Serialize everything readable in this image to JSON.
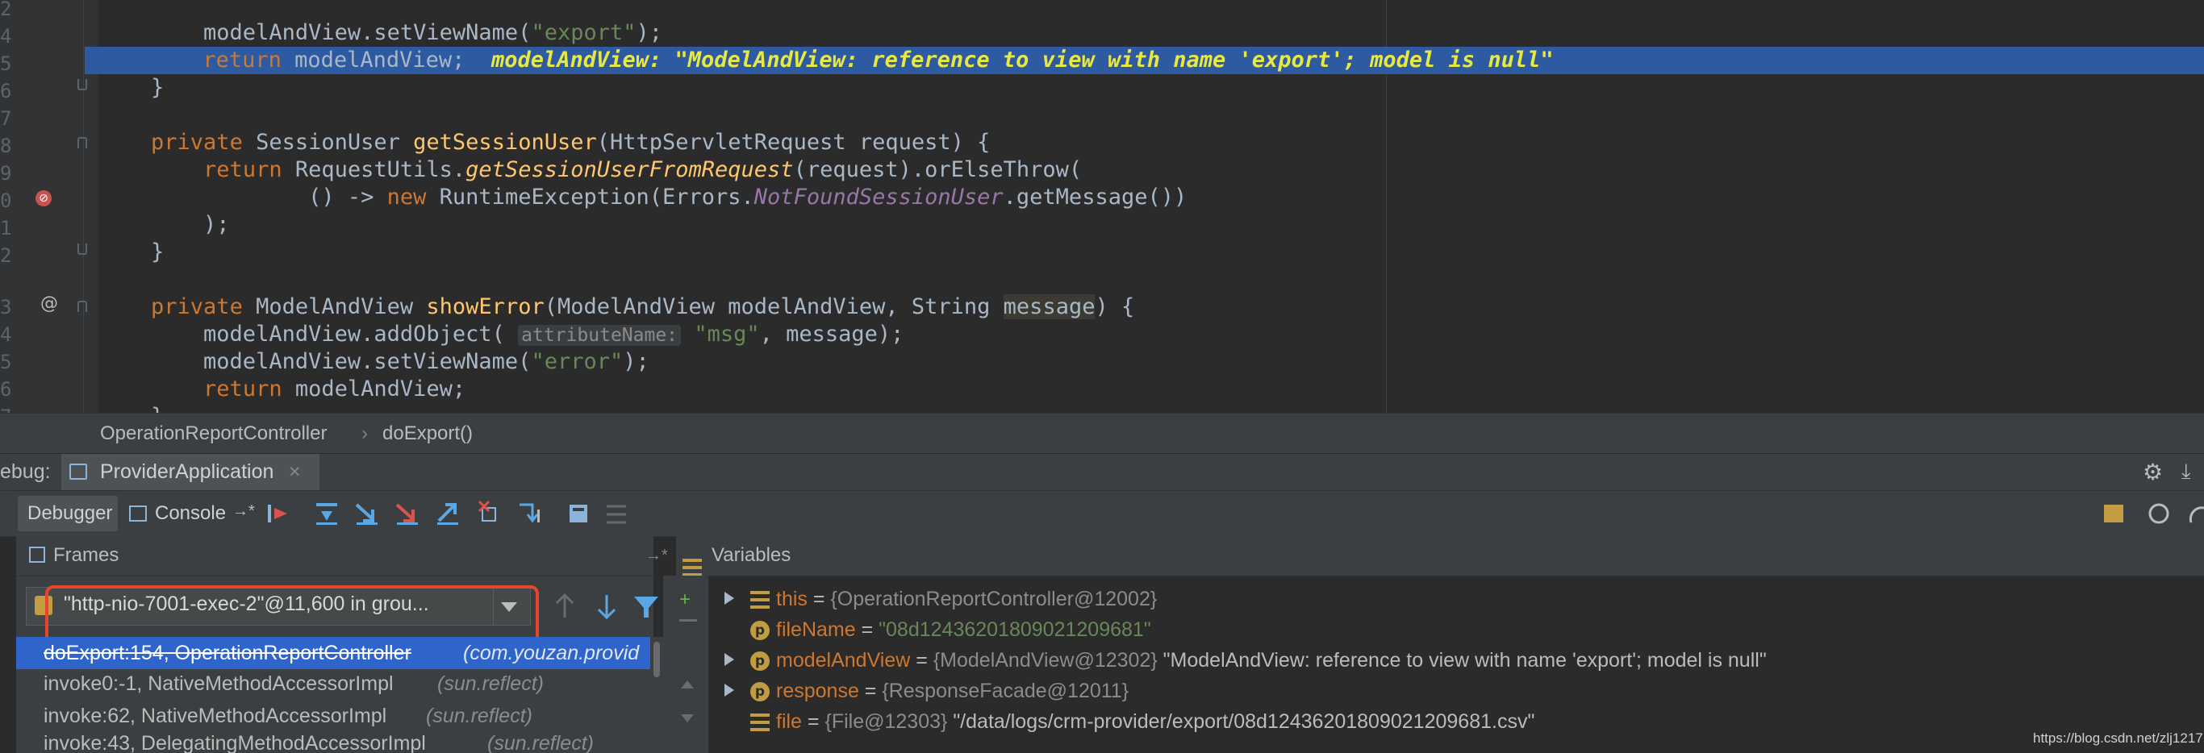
{
  "editor": {
    "line_numbers": [
      "2",
      "4",
      "5",
      "6",
      "7",
      "8",
      "9",
      "0",
      "1",
      "2",
      "3",
      "4",
      "5",
      "6",
      "7"
    ],
    "lines": [
      {
        "code": "        modelAndView.setViewName(\"export\");"
      },
      {
        "code": "        return modelAndView;",
        "inline": "modelAndView: \"ModelAndView: reference to view with name 'export'; model is null\""
      },
      {
        "code": "    }"
      },
      {
        "code": ""
      },
      {
        "code": "    private SessionUser getSessionUser(HttpServletRequest request) {"
      },
      {
        "code": "        return RequestUtils.getSessionUserFromRequest(request).orElseThrow("
      },
      {
        "code": "                () -> new RuntimeException(Errors.NotFoundSessionUser.getMessage())"
      },
      {
        "code": "        );"
      },
      {
        "code": "    }"
      },
      {
        "code": ""
      },
      {
        "code": "    private ModelAndView showError(ModelAndView modelAndView, String message) {"
      },
      {
        "code": "        modelAndView.addObject(",
        "hint": "attributeName:",
        "rest": "\"msg\", message);"
      },
      {
        "code": "        modelAndView.setViewName(\"error\");"
      },
      {
        "code": "        return modelAndView;"
      },
      {
        "code": "    }"
      }
    ]
  },
  "breadcrumb": {
    "class": "OperationReportController",
    "method": "doExport()"
  },
  "debug": {
    "title_prefix": "ebug:",
    "tab_label": "ProviderApplication",
    "debugger_tab": "Debugger",
    "console_tab": "Console"
  },
  "frames": {
    "header": "Frames",
    "thread": "\"http-nio-7001-exec-2\"@11,600 in grou...",
    "rows": [
      {
        "method": "doExport:154, OperationReportController",
        "pkg": "(com.youzan.provid"
      },
      {
        "method": "invoke0:-1, NativeMethodAccessorImpl",
        "pkg": "(sun.reflect)"
      },
      {
        "method": "invoke:62, NativeMethodAccessorImpl",
        "pkg": "(sun.reflect)"
      },
      {
        "method": "invoke:43, DelegatingMethodAccessorImpl",
        "pkg": "(sun.reflect)"
      }
    ]
  },
  "variables": {
    "header": "Variables",
    "rows": [
      {
        "name": "this",
        "ref": "{OperationReportController@12002}",
        "value": ""
      },
      {
        "name": "fileName",
        "ref": "",
        "value": "\"08d12436201809021209681\""
      },
      {
        "name": "modelAndView",
        "ref": "{ModelAndView@12302}",
        "value": "\"ModelAndView: reference to view with name 'export'; model is null\""
      },
      {
        "name": "response",
        "ref": "{ResponseFacade@12011}",
        "value": ""
      },
      {
        "name": "file",
        "ref": "{File@12303}",
        "value": "\"/data/logs/crm-provider/export/08d12436201809021209681.csv\""
      }
    ]
  },
  "watermark": "https://blog.csdn.net/zlj1217",
  "colors": {
    "exec_line": "#2d5aa0",
    "selected_frame": "#2f65ca",
    "annotation_box": "#e8452c"
  }
}
